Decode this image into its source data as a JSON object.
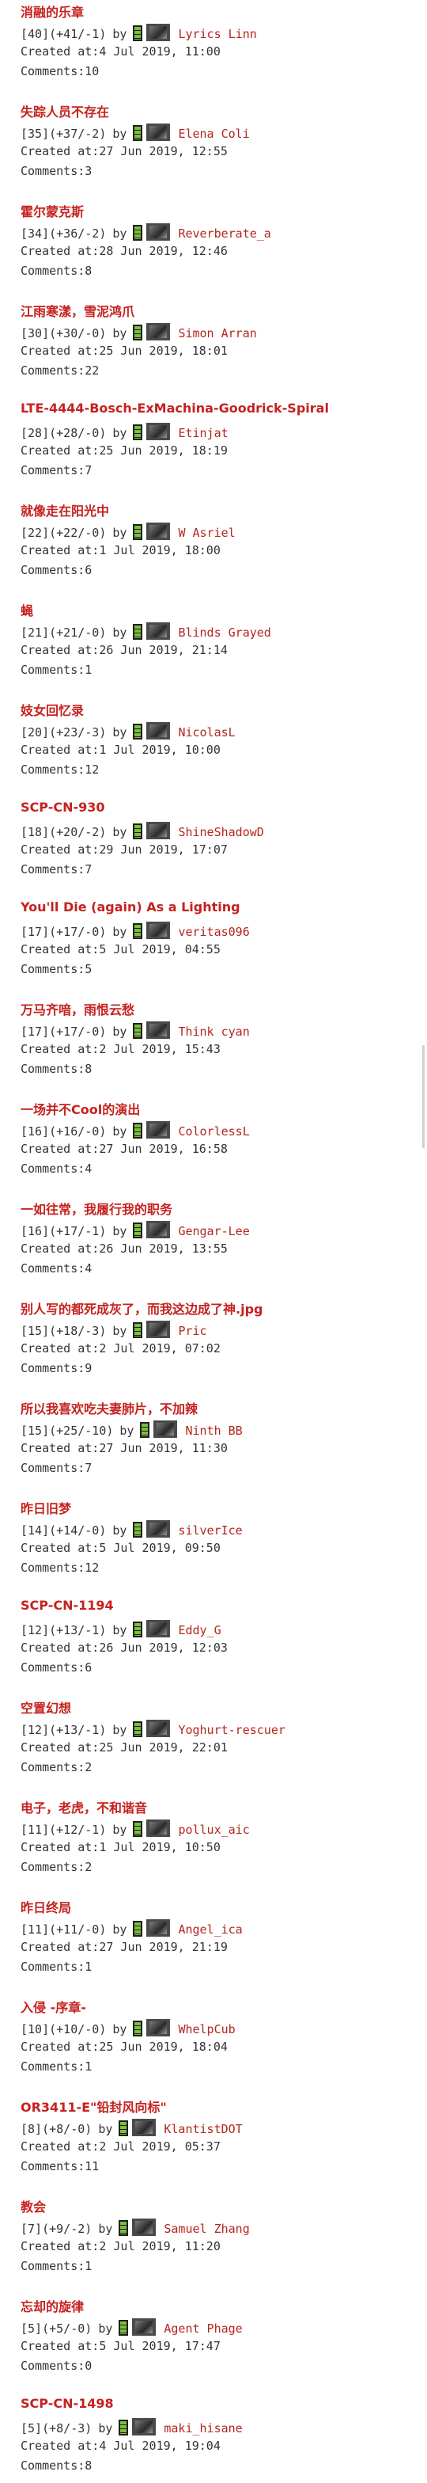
{
  "labels": {
    "by": "by",
    "created_prefix": "Created at:",
    "comments_prefix": "Comments:"
  },
  "entries": [
    {
      "title": "消融的乐章",
      "rating": "[40](+41/-1)",
      "user": "Lyrics Linn",
      "created": "4 Jul 2019, 11:00",
      "comments": "10"
    },
    {
      "title": "失踪人员不存在",
      "rating": "[35](+37/-2)",
      "user": "Elena Coli",
      "created": "27 Jun 2019, 12:55",
      "comments": "3"
    },
    {
      "title": "霍尔蒙克斯",
      "rating": "[34](+36/-2)",
      "user": "Reverberate_a",
      "created": "28 Jun 2019, 12:46",
      "comments": "8"
    },
    {
      "title": "江雨寒漾，雪泥鸿爪",
      "rating": "[30](+30/-0)",
      "user": "Simon Arran",
      "created": "25 Jun 2019, 18:01",
      "comments": "22"
    },
    {
      "title": "LTE-4444-Bosch-ExMachina-Goodrick-Spiral",
      "rating": "[28](+28/-0)",
      "user": "Etinjat",
      "created": "25 Jun 2019, 18:19",
      "comments": "7"
    },
    {
      "title": "就像走在阳光中",
      "rating": "[22](+22/-0)",
      "user": "W Asriel",
      "created": "1 Jul 2019, 18:00",
      "comments": "6"
    },
    {
      "title": "蝇",
      "rating": "[21](+21/-0)",
      "user": "Blinds Grayed",
      "created": "26 Jun 2019, 21:14",
      "comments": "1"
    },
    {
      "title": "妓女回忆录",
      "rating": "[20](+23/-3)",
      "user": "NicolasL",
      "created": "1 Jul 2019, 10:00",
      "comments": "12"
    },
    {
      "title": "SCP-CN-930",
      "rating": "[18](+20/-2)",
      "user": "ShineShadowD",
      "created": "29 Jun 2019, 17:07",
      "comments": "7"
    },
    {
      "title": "You'll Die (again) As a Lighting",
      "rating": "[17](+17/-0)",
      "user": "veritas096",
      "created": "5 Jul 2019, 04:55",
      "comments": "5"
    },
    {
      "title": "万马齐喑，雨恨云愁",
      "rating": "[17](+17/-0)",
      "user": "Think cyan",
      "created": "2 Jul 2019, 15:43",
      "comments": "8"
    },
    {
      "title": "一场并不Cool的演出",
      "rating": "[16](+16/-0)",
      "user": "ColorlessL",
      "created": "27 Jun 2019, 16:58",
      "comments": "4"
    },
    {
      "title": "一如往常，我履行我的职务",
      "rating": "[16](+17/-1)",
      "user": "Gengar-Lee",
      "created": "26 Jun 2019, 13:55",
      "comments": "4"
    },
    {
      "title": "别人写的都死成灰了，而我这边成了神.jpg",
      "rating": "[15](+18/-3)",
      "user": "Pric",
      "created": "2 Jul 2019, 07:02",
      "comments": "9"
    },
    {
      "title": "所以我喜欢吃夫妻肺片，不加辣",
      "rating": "[15](+25/-10)",
      "user": "Ninth BB",
      "created": "27 Jun 2019, 11:30",
      "comments": "7"
    },
    {
      "title": "昨日旧梦",
      "rating": "[14](+14/-0)",
      "user": "silverIce",
      "created": "5 Jul 2019, 09:50",
      "comments": "12"
    },
    {
      "title": "SCP-CN-1194",
      "rating": "[12](+13/-1)",
      "user": "Eddy_G",
      "created": "26 Jun 2019, 12:03",
      "comments": "6"
    },
    {
      "title": "空置幻想",
      "rating": "[12](+13/-1)",
      "user": "Yoghurt-rescuer",
      "created": "25 Jun 2019, 22:01",
      "comments": "2"
    },
    {
      "title": "电子，老虎，不和谐音",
      "rating": "[11](+12/-1)",
      "user": "pollux_aic",
      "created": "1 Jul 2019, 10:50",
      "comments": "2"
    },
    {
      "title": "昨日终局",
      "rating": "[11](+11/-0)",
      "user": "Angel_ica",
      "created": "27 Jun 2019, 21:19",
      "comments": "1"
    },
    {
      "title": "入侵 -序章-",
      "rating": "[10](+10/-0)",
      "user": "WhelpCub",
      "created": "25 Jun 2019, 18:04",
      "comments": "1"
    },
    {
      "title": "OR3411-E\"铅封风向标\"",
      "rating": "[8](+8/-0)",
      "user": "KlantistDOT",
      "created": "2 Jul 2019, 05:37",
      "comments": "11"
    },
    {
      "title": "教会",
      "rating": "[7](+9/-2)",
      "user": "Samuel Zhang",
      "created": "2 Jul 2019, 11:20",
      "comments": "1"
    },
    {
      "title": "忘却的旋律",
      "rating": "[5](+5/-0)",
      "user": "Agent Phage",
      "created": "5 Jul 2019, 17:47",
      "comments": "0"
    },
    {
      "title": "SCP-CN-1498",
      "rating": "[5](+8/-3)",
      "user": "maki_hisane",
      "created": "4 Jul 2019, 19:04",
      "comments": "8"
    }
  ]
}
